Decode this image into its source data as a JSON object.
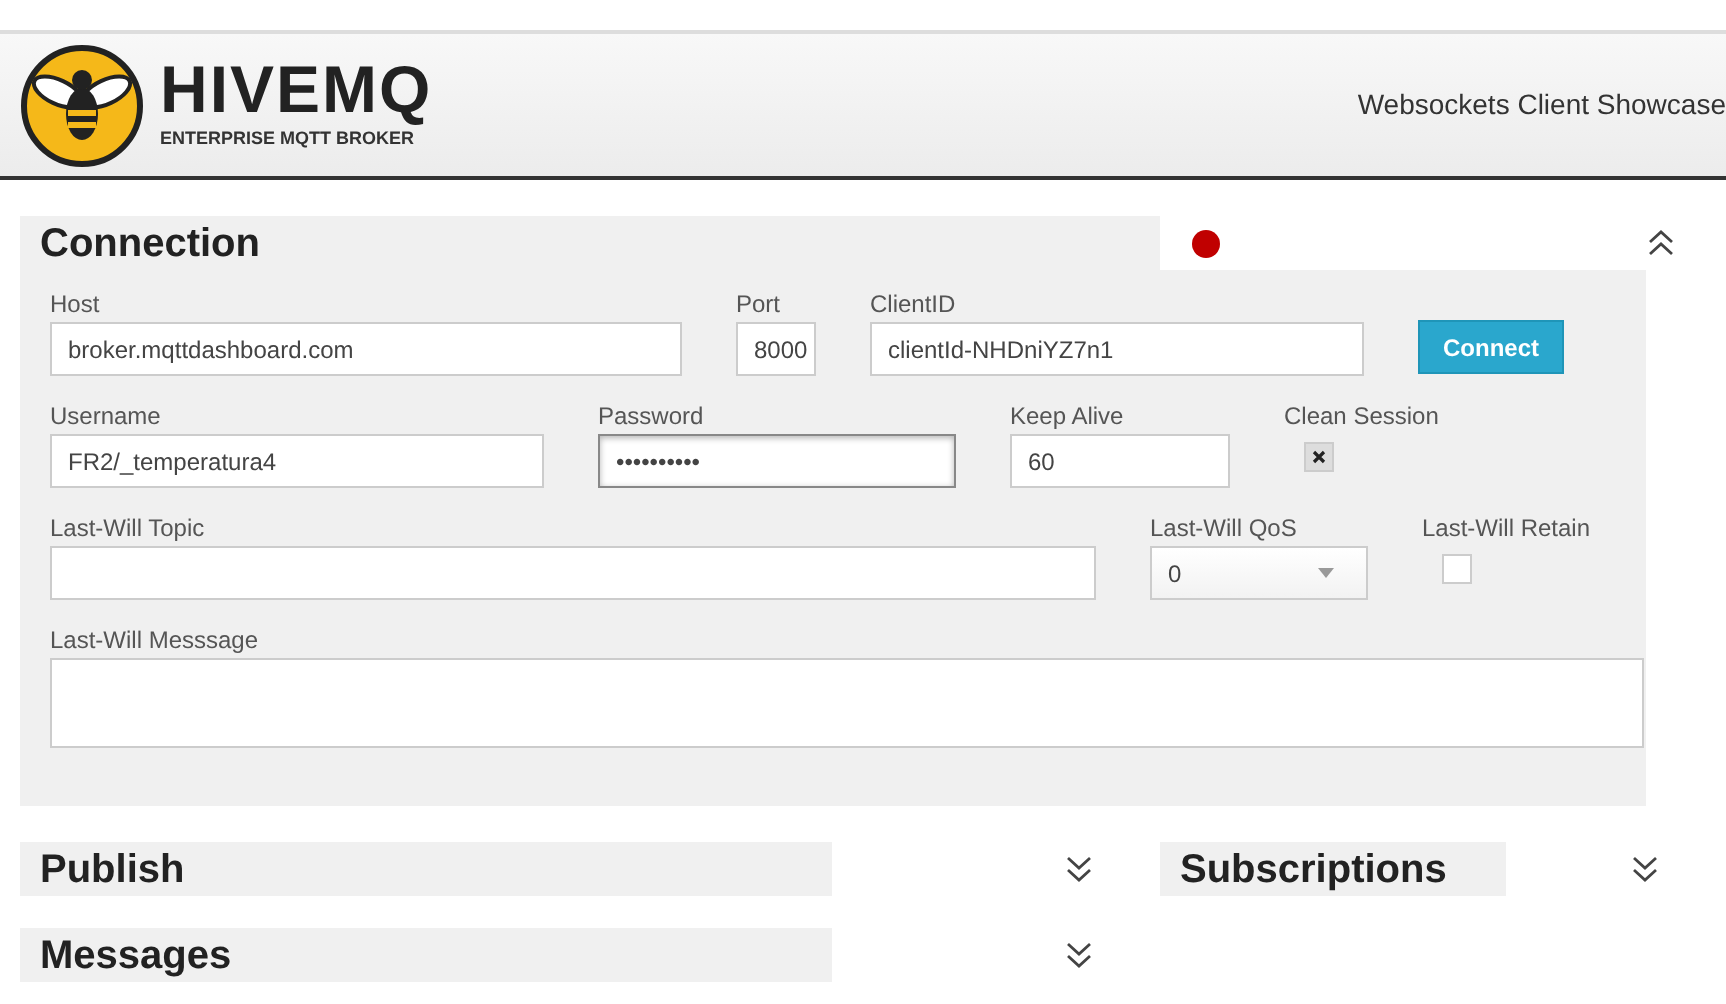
{
  "header": {
    "logo_title": "HIVEMQ",
    "logo_subtitle": "ENTERPRISE MQTT BROKER",
    "title": "Websockets Client Showcase"
  },
  "connection": {
    "title": "Connection",
    "connected": false,
    "expanded": true,
    "rows": [
      [
        {
          "kind": "text",
          "label": "Host",
          "value": "broker.mqttdashboard.com"
        },
        {
          "kind": "text",
          "label": "Port",
          "value": "8000"
        },
        {
          "kind": "text",
          "label": "ClientID",
          "value": "clientId-NHDniYZ7n1"
        },
        {
          "kind": "button",
          "label": "Connect"
        }
      ],
      [
        {
          "kind": "text",
          "label": "Username",
          "value": "FR2/_temperatura4"
        },
        {
          "kind": "password",
          "label": "Password",
          "value": "••••••••••",
          "focused": true
        },
        {
          "kind": "text",
          "label": "Keep Alive",
          "value": "60"
        },
        {
          "kind": "checkbox",
          "label": "Clean Session",
          "checked": true
        }
      ],
      [
        {
          "kind": "text",
          "label": "Last-Will Topic"
        },
        {
          "kind": "select",
          "label": "Last-Will QoS",
          "value": "0"
        },
        {
          "kind": "checkbox",
          "label": "Last-Will Retain",
          "checked": false
        }
      ],
      [
        {
          "kind": "textarea",
          "label": "Last-Will Messsage"
        }
      ]
    ]
  },
  "sections": [
    {
      "title": "Publish",
      "expanded": false
    },
    {
      "title": "Subscriptions",
      "expanded": false
    },
    {
      "title": "Messages",
      "expanded": false
    }
  ]
}
